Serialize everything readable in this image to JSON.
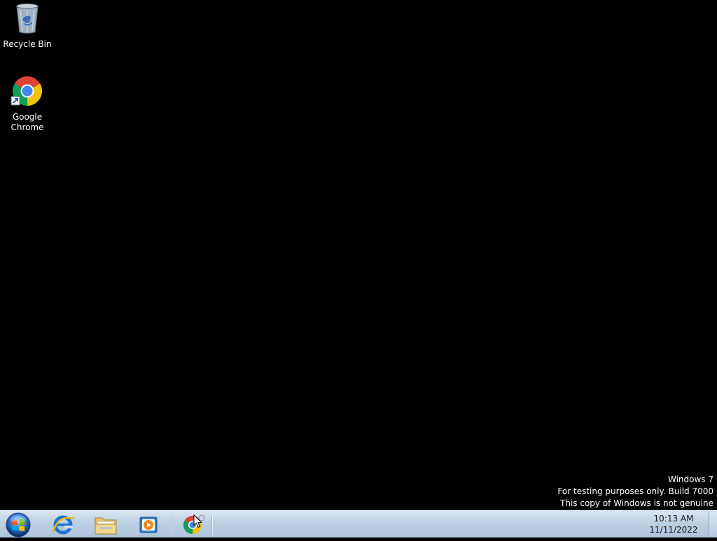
{
  "desktop": {
    "icons": [
      {
        "label": "Recycle Bin",
        "icon": "recycle-bin-icon"
      },
      {
        "label": "Google Chrome",
        "icon": "chrome-icon"
      }
    ]
  },
  "watermark": {
    "line1": "Windows  7",
    "line2": "For testing purposes only. Build 7000",
    "line3": "This copy of Windows is not genuine"
  },
  "taskbar": {
    "start_icon": "windows-start-orb-icon",
    "pinned": [
      {
        "name": "Internet Explorer",
        "icon": "internet-explorer-icon"
      },
      {
        "name": "Windows Explorer",
        "icon": "folder-icon"
      },
      {
        "name": "Windows Media Player",
        "icon": "media-player-icon"
      },
      {
        "name": "Google Chrome",
        "icon": "chrome-icon"
      }
    ],
    "clock": {
      "time": "10:13 AM",
      "date": "11/11/2022"
    }
  },
  "colors": {
    "desktop_bg": "#000000",
    "taskbar_top": "#d9e4ef",
    "taskbar_bottom": "#aec4da",
    "text_on_desktop": "#ffffff"
  }
}
